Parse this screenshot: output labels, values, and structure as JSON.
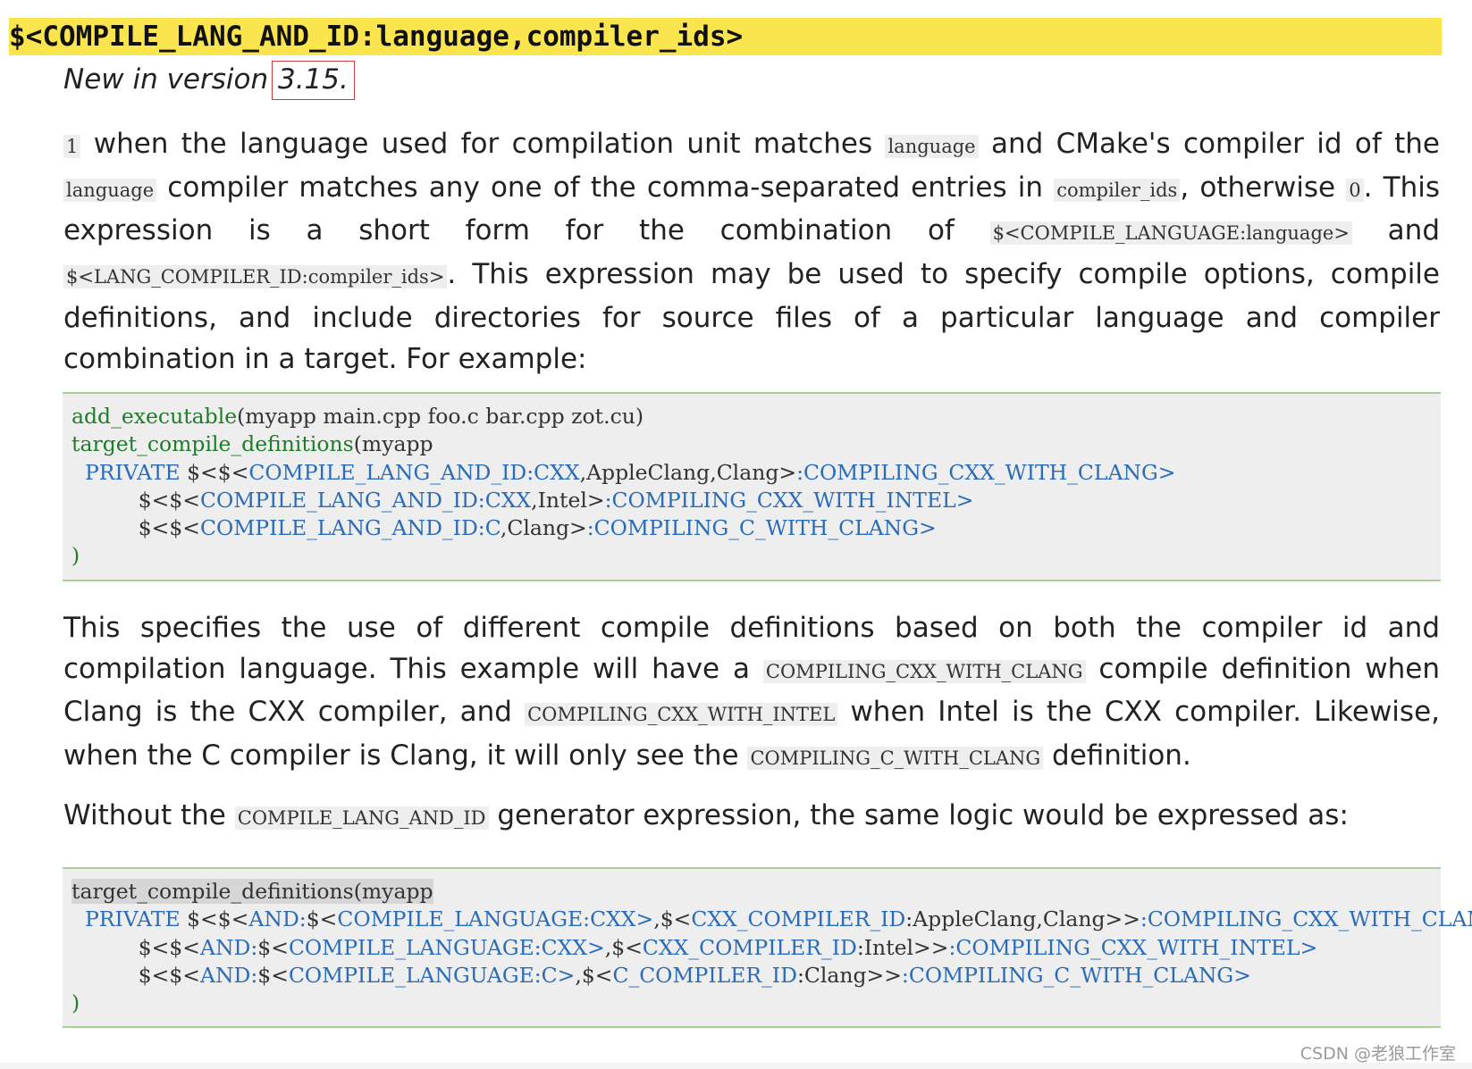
{
  "signature": "$<COMPILE_LANG_AND_ID:language,compiler_ids>",
  "version": {
    "prefix": "New in version ",
    "number": "3.15."
  },
  "para1": [
    {
      "code": "1"
    },
    {
      "text": " when the language used for compilation unit matches "
    },
    {
      "code": "language"
    },
    {
      "text": " and CMake's compiler id of the "
    },
    {
      "code": "language"
    },
    {
      "text": " compiler matches any one of the comma-separated entries in "
    },
    {
      "code": "compiler_ids"
    },
    {
      "text": ", otherwise "
    },
    {
      "code": "0"
    },
    {
      "text": ". This expression is a short form for the combination of "
    },
    {
      "code": "$<COMPILE_LANGUAGE:language>"
    },
    {
      "text": " and "
    },
    {
      "code": "$<LANG_COMPILER_ID:compiler_ids>"
    },
    {
      "text": ". This expression may be used to specify compile options, compile defini­tions, and include directories for source files of a particular language and compiler combination in a target. For example:"
    }
  ],
  "code1": [
    [
      {
        "t": "add_executable",
        "c": "g"
      },
      {
        "t": "(myapp main.cpp foo.c bar.cpp zot.cu)"
      }
    ],
    [
      {
        "t": "target_compile_definitions",
        "c": "g"
      },
      {
        "t": "(myapp"
      }
    ],
    [
      {
        "t": "  "
      },
      {
        "t": "PRIVATE",
        "c": "b"
      },
      {
        "t": " $<$<"
      },
      {
        "t": "COMPILE_LANG_AND_ID:CXX",
        "c": "b"
      },
      {
        "t": ",AppleClang,Clang>"
      },
      {
        "t": ":COMPILING_CXX_WITH_CLANG>",
        "c": "b"
      }
    ],
    [
      {
        "t": "          $<$<"
      },
      {
        "t": "COMPILE_LANG_AND_ID:CXX",
        "c": "b"
      },
      {
        "t": ",Intel>"
      },
      {
        "t": ":COMPILING_CXX_WITH_INTEL>",
        "c": "b"
      }
    ],
    [
      {
        "t": "          $<$<"
      },
      {
        "t": "COMPILE_LANG_AND_ID:C",
        "c": "b"
      },
      {
        "t": ",Clang>"
      },
      {
        "t": ":COMPILING_C_WITH_CLANG>",
        "c": "b"
      }
    ],
    [
      {
        "t": ")",
        "c": "g"
      }
    ]
  ],
  "para2": [
    {
      "text": "This specifies the use of different compile definitions based on both the compiler id and compilation language. This example will have a "
    },
    {
      "code": "COMPILING_CXX_WITH_CLANG"
    },
    {
      "text": " compile definition when Clang is the CXX compiler, and "
    },
    {
      "code": "COMPILING_CXX_WITH_INTEL"
    },
    {
      "text": " when Intel is the CXX compiler. Likewise, when the C compiler is Clang, it will only see the "
    },
    {
      "code": "COMPILING_C_WITH_CLANG"
    },
    {
      "text": " definition."
    }
  ],
  "para3": [
    {
      "text": "Without the "
    },
    {
      "code": "COMPILE_LANG_AND_ID"
    },
    {
      "text": " generator expression, the same logic would be expressed as:"
    }
  ],
  "code2": [
    [
      {
        "t": "target_compile_definitions(myapp",
        "c": "hl"
      }
    ],
    [
      {
        "t": "  "
      },
      {
        "t": "PRIVATE",
        "c": "b"
      },
      {
        "t": " $<$<"
      },
      {
        "t": "AND:",
        "c": "b"
      },
      {
        "t": "$<"
      },
      {
        "t": "COMPILE_LANGUAGE:CXX>",
        "c": "b"
      },
      {
        "t": ",$<"
      },
      {
        "t": "CXX_COMPILER_ID",
        "c": "b"
      },
      {
        "t": ":AppleClang,Clang>>"
      },
      {
        "t": ":COMPILING_CXX_WITH_CLANG>",
        "c": "b"
      }
    ],
    [
      {
        "t": "          $<$<"
      },
      {
        "t": "AND:",
        "c": "b"
      },
      {
        "t": "$<"
      },
      {
        "t": "COMPILE_LANGUAGE:CXX>",
        "c": "b"
      },
      {
        "t": ",$<"
      },
      {
        "t": "CXX_COMPILER_ID",
        "c": "b"
      },
      {
        "t": ":Intel>>"
      },
      {
        "t": ":COMPILING_CXX_WITH_INTEL>",
        "c": "b"
      }
    ],
    [
      {
        "t": "          $<$<"
      },
      {
        "t": "AND:",
        "c": "b"
      },
      {
        "t": "$<"
      },
      {
        "t": "COMPILE_LANGUAGE:C>",
        "c": "b"
      },
      {
        "t": ",$<"
      },
      {
        "t": "C_COMPILER_ID",
        "c": "b"
      },
      {
        "t": ":Clang>>"
      },
      {
        "t": ":COMPILING_C_WITH_CLANG>",
        "c": "b"
      }
    ],
    [
      {
        "t": ")",
        "c": "g"
      }
    ]
  ],
  "watermark": "CSDN @老狼工作室"
}
